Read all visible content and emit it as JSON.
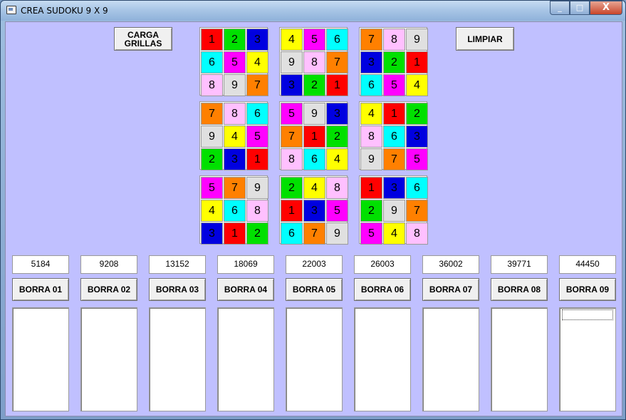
{
  "window": {
    "title": "CREA SUDOKU 9 X 9"
  },
  "controls": {
    "minimize": "_",
    "maximize": "□",
    "close": "X"
  },
  "buttons": {
    "load": "CARGA\nGRILLAS",
    "clear": "LIMPIAR"
  },
  "colors": {
    "1": "#ff0000",
    "2": "#00e000",
    "3": "#0000e0",
    "4": "#ffff00",
    "5": "#ff00ff",
    "6": "#00ffff",
    "7": "#ff8000",
    "8": "#ffc0ff",
    "9": "#e0e0e0"
  },
  "grid": [
    [
      1,
      2,
      3,
      4,
      5,
      6,
      7,
      8,
      9
    ],
    [
      6,
      5,
      4,
      9,
      8,
      7,
      3,
      2,
      1
    ],
    [
      8,
      9,
      7,
      3,
      2,
      1,
      6,
      5,
      4
    ],
    [
      7,
      8,
      6,
      5,
      9,
      3,
      4,
      1,
      2
    ],
    [
      9,
      4,
      5,
      7,
      1,
      2,
      8,
      6,
      3
    ],
    [
      2,
      3,
      1,
      8,
      6,
      4,
      9,
      7,
      5
    ],
    [
      5,
      7,
      9,
      2,
      4,
      8,
      1,
      3,
      6
    ],
    [
      4,
      6,
      8,
      1,
      3,
      5,
      2,
      9,
      7
    ],
    [
      3,
      1,
      2,
      6,
      7,
      9,
      5,
      4,
      8
    ]
  ],
  "columns": [
    {
      "count": "5184",
      "label": "BORRA 01"
    },
    {
      "count": "9208",
      "label": "BORRA 02"
    },
    {
      "count": "13152",
      "label": "BORRA 03"
    },
    {
      "count": "18069",
      "label": "BORRA 04"
    },
    {
      "count": "22003",
      "label": "BORRA 05"
    },
    {
      "count": "26003",
      "label": "BORRA 06"
    },
    {
      "count": "36002",
      "label": "BORRA 07"
    },
    {
      "count": "39771",
      "label": "BORRA 08"
    },
    {
      "count": "44450",
      "label": "BORRA 09"
    }
  ]
}
